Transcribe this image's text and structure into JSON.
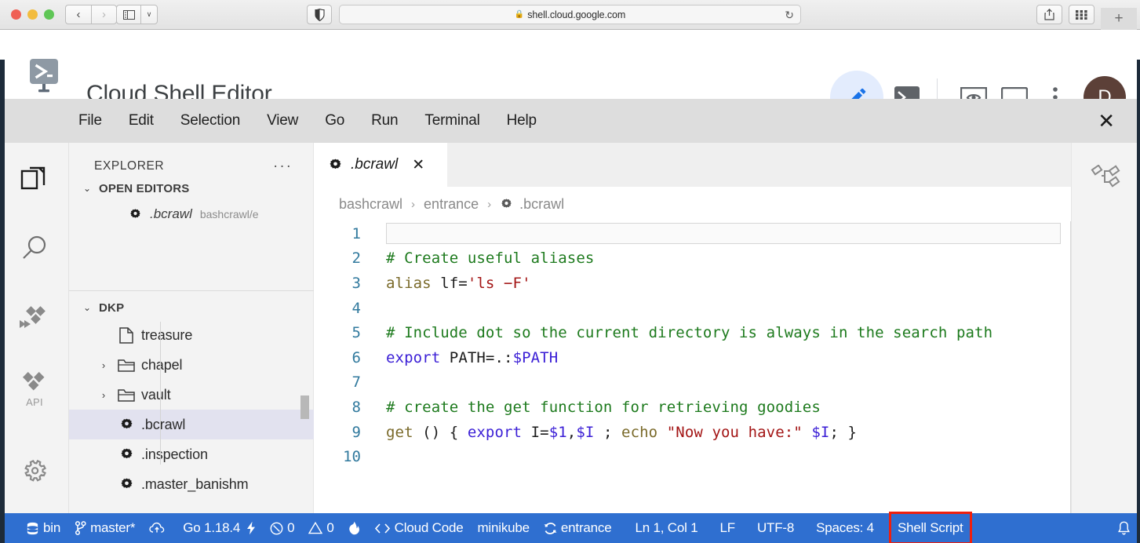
{
  "browser": {
    "url": "shell.cloud.google.com",
    "lock_icon": "lock-icon",
    "reload_icon": "reload-icon",
    "back_label": "‹",
    "forward_label": "›",
    "sidebar_toggle_icon": "sidebar-toggle-icon",
    "sidebar_dropdown_label": "∨",
    "privacy_icon": "privacy-shield-icon",
    "share_icon": "share-icon",
    "tabs_overview_icon": "tab-overview-icon",
    "new_tab_label": "+"
  },
  "header": {
    "title": "Cloud Shell Editor",
    "logo_icon": "cloud-shell-logo-icon",
    "actions": [
      {
        "name": "open-editor-button",
        "icon": "pencil-icon",
        "active": true
      },
      {
        "name": "open-terminal-button",
        "icon": "terminal-icon",
        "active": false
      },
      {
        "name": "web-preview-button",
        "icon": "web-preview-icon",
        "active": false
      },
      {
        "name": "new-terminal-panel-button",
        "icon": "panel-icon",
        "active": false
      },
      {
        "name": "more-options-button",
        "icon": "kebab-menu-icon",
        "active": false
      }
    ],
    "avatar_initial": "D",
    "avatar_color": "#5c4038"
  },
  "menubar": {
    "items": [
      "File",
      "Edit",
      "Selection",
      "View",
      "Go",
      "Run",
      "Terminal",
      "Help"
    ],
    "close_label": "✕"
  },
  "activitybar": {
    "items": [
      {
        "name": "sidebar-item-explorer",
        "icon": "files-icon",
        "label": "",
        "active": true
      },
      {
        "name": "sidebar-item-search",
        "icon": "search-icon",
        "label": "",
        "active": false
      },
      {
        "name": "sidebar-item-cloud-code",
        "icon": "cloud-code-icon",
        "label": "",
        "active": false
      },
      {
        "name": "sidebar-item-api",
        "icon": "api-icon",
        "label": "API",
        "active": false
      },
      {
        "name": "sidebar-item-settings",
        "icon": "gear-icon",
        "label": "",
        "active": false
      }
    ]
  },
  "right_activitybar": {
    "items": [
      {
        "name": "sidebar-item-outline-graph",
        "icon": "graph-nodes-icon"
      }
    ]
  },
  "explorer": {
    "title": "EXPLORER",
    "more_label": "···",
    "open_editors": {
      "label": "OPEN EDITORS",
      "chevron": "⌄",
      "items": [
        {
          "icon": "gear-file-icon",
          "name": ".bcrawl",
          "path": "bashcrawl/e"
        }
      ]
    },
    "workspace": {
      "label": "DKP",
      "chevron": "⌄",
      "items": [
        {
          "icon": "file-icon",
          "label": "treasure",
          "arrow": "",
          "selected": false
        },
        {
          "icon": "folder-icon",
          "label": "chapel",
          "arrow": "›",
          "selected": false
        },
        {
          "icon": "folder-icon",
          "label": "vault",
          "arrow": "›",
          "selected": false
        },
        {
          "icon": "gear-file-icon",
          "label": ".bcrawl",
          "arrow": "",
          "selected": true
        },
        {
          "icon": "gear-file-icon",
          "label": ".inspection",
          "arrow": "",
          "selected": false
        },
        {
          "icon": "gear-file-icon",
          "label": ".master_banishm",
          "arrow": "",
          "selected": false
        }
      ]
    }
  },
  "editor": {
    "tab": {
      "icon": "gear-file-icon",
      "name": ".bcrawl",
      "close_label": "✕"
    },
    "breadcrumb": {
      "parts": [
        "bashcrawl",
        "entrance",
        ".bcrawl"
      ],
      "separator": "›",
      "file_icon": "gear-file-icon"
    },
    "lines": [
      {
        "num": "1",
        "segments": []
      },
      {
        "num": "2",
        "segments": [
          {
            "t": "# Create useful aliases",
            "c": "c-comment"
          }
        ]
      },
      {
        "num": "3",
        "segments": [
          {
            "t": "alias ",
            "c": "c-fn"
          },
          {
            "t": "lf=",
            "c": "c-plain"
          },
          {
            "t": "'ls −F'",
            "c": "c-str"
          }
        ]
      },
      {
        "num": "4",
        "segments": []
      },
      {
        "num": "5",
        "segments": [
          {
            "t": "# Include dot so the current directory is always in the search path",
            "c": "c-comment"
          }
        ]
      },
      {
        "num": "6",
        "segments": [
          {
            "t": "export ",
            "c": "c-kw"
          },
          {
            "t": "PATH=.:",
            "c": "c-plain"
          },
          {
            "t": "$PATH",
            "c": "c-var"
          }
        ]
      },
      {
        "num": "7",
        "segments": []
      },
      {
        "num": "8",
        "segments": [
          {
            "t": "# create the get function for retrieving goodies",
            "c": "c-comment"
          }
        ]
      },
      {
        "num": "9",
        "segments": [
          {
            "t": "get ",
            "c": "c-fn"
          },
          {
            "t": "() { ",
            "c": "c-plain"
          },
          {
            "t": "export ",
            "c": "c-kw"
          },
          {
            "t": "I=",
            "c": "c-plain"
          },
          {
            "t": "$1",
            "c": "c-var"
          },
          {
            "t": ",",
            "c": "c-plain"
          },
          {
            "t": "$I",
            "c": "c-var"
          },
          {
            "t": " ; ",
            "c": "c-plain"
          },
          {
            "t": "echo ",
            "c": "c-fn"
          },
          {
            "t": "\"Now you have:\"",
            "c": "c-str"
          },
          {
            "t": " ",
            "c": "c-plain"
          },
          {
            "t": "$I",
            "c": "c-var"
          },
          {
            "t": "; }",
            "c": "c-plain"
          }
        ]
      },
      {
        "num": "10",
        "segments": []
      }
    ]
  },
  "statusbar": {
    "background": "#2f6fd0",
    "highlight_color": "#f01f0d",
    "items": [
      {
        "name": "status-bin",
        "icon": "database-icon",
        "label": "bin"
      },
      {
        "name": "status-branch",
        "icon": "source-branch-icon",
        "label": "master*"
      },
      {
        "name": "status-sync",
        "icon": "cloud-upload-icon",
        "label": ""
      },
      {
        "name": "status-go-version",
        "icon": "",
        "label": "Go 1.18.4"
      },
      {
        "name": "status-lightning",
        "icon": "lightning-icon",
        "label": ""
      },
      {
        "name": "status-errors",
        "icon": "error-circle-icon",
        "label": "0"
      },
      {
        "name": "status-warnings",
        "icon": "warning-triangle-icon",
        "label": "0"
      },
      {
        "name": "status-flame",
        "icon": "flame-icon",
        "label": ""
      },
      {
        "name": "status-cloud-code",
        "icon": "code-brackets-icon",
        "label": "Cloud Code"
      },
      {
        "name": "status-minikube",
        "icon": "",
        "label": "minikube"
      },
      {
        "name": "status-entrance",
        "icon": "refresh-icon",
        "label": "entrance"
      },
      {
        "name": "status-cursor",
        "icon": "",
        "label": "Ln 1, Col 1"
      },
      {
        "name": "status-eol",
        "icon": "",
        "label": "LF"
      },
      {
        "name": "status-encoding",
        "icon": "",
        "label": "UTF-8"
      },
      {
        "name": "status-indent",
        "icon": "",
        "label": "Spaces: 4"
      },
      {
        "name": "status-language",
        "icon": "",
        "label": "Shell Script",
        "highlighted": true
      },
      {
        "name": "status-notifications",
        "icon": "bell-icon",
        "label": ""
      }
    ]
  }
}
